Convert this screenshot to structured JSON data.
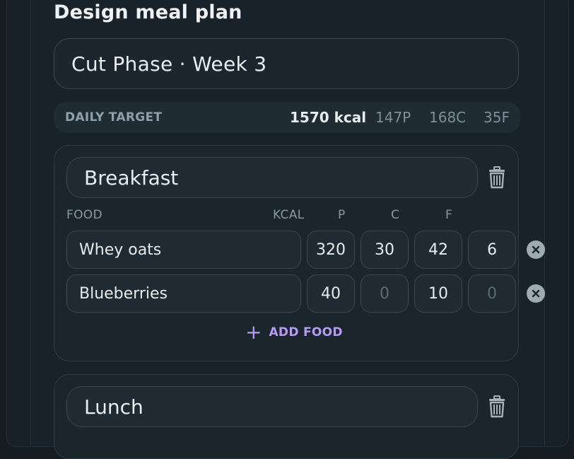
{
  "page": {
    "title": "Design meal plan"
  },
  "plan": {
    "name": "Cut Phase · Week 3"
  },
  "daily_target": {
    "label": "DAILY TARGET",
    "kcal": "1570 kcal",
    "protein": "147P",
    "carbs": "168C",
    "fat": "35F"
  },
  "columns": {
    "food": "FOOD",
    "kcal": "KCAL",
    "protein": "P",
    "carbs": "C",
    "fat": "F"
  },
  "meals": [
    {
      "name": "Breakfast",
      "foods": [
        {
          "name": "Whey oats",
          "kcal": "320",
          "p": "30",
          "c": "42",
          "f": "6"
        },
        {
          "name": "Blueberries",
          "kcal": "40",
          "p": "0",
          "c": "10",
          "f": "0"
        }
      ],
      "add_label": "ADD FOOD"
    },
    {
      "name": "Lunch"
    }
  ],
  "icons": {
    "delete_meal": "trash-icon",
    "remove_food": "close-circle-icon",
    "add": "plus-icon"
  },
  "colors": {
    "accent": "#b59cf2",
    "background": "#151d23"
  }
}
